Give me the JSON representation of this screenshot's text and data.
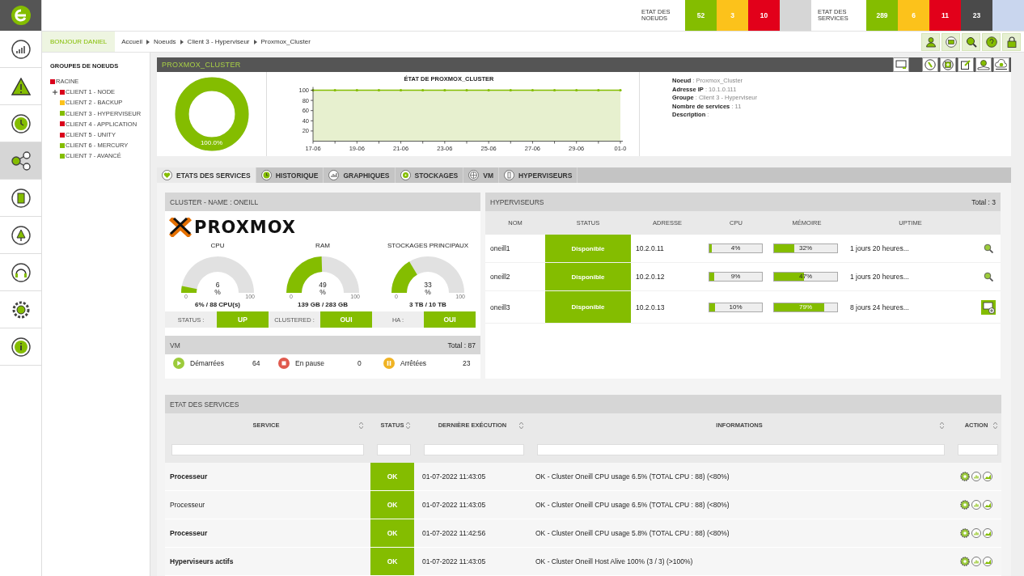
{
  "rail": {
    "items": [
      {
        "selected": false
      },
      {
        "selected": false
      },
      {
        "selected": false
      },
      {
        "selected": true
      },
      {
        "selected": false
      },
      {
        "selected": false
      },
      {
        "selected": false
      },
      {
        "selected": false
      },
      {
        "selected": false
      }
    ]
  },
  "top_bar": {
    "groups": [
      {
        "label": "ETAT DES NOEUDS",
        "counts": [
          {
            "value": "52",
            "color": "#84bd00"
          },
          {
            "value": "3",
            "color": "#fcc21b"
          },
          {
            "value": "10",
            "color": "#e2001a"
          },
          {
            "color": "#d6d6d6"
          }
        ]
      },
      {
        "label": "ETAT DES SERVICES",
        "counts": [
          {
            "value": "289",
            "color": "#84bd00"
          },
          {
            "value": "6",
            "color": "#fcc21b"
          },
          {
            "value": "11",
            "color": "#e2001a"
          },
          {
            "value": "23",
            "color": "#4a4a4a"
          },
          {
            "color": "#c9d6ee"
          }
        ]
      }
    ]
  },
  "greeting": "BONJOUR DANIEL",
  "breadcrumb": [
    "Accueil",
    "Noeuds",
    "Client 3 - Hyperviseur",
    "Proxmox_Cluster"
  ],
  "node_groups": {
    "title": "GROUPES DE NOEUDS",
    "root": {
      "label": "RACINE",
      "color": "#d9001b",
      "children": [
        {
          "label": "CLIENT 1 - NODE",
          "color": "#d9001b",
          "expandable": true
        },
        {
          "label": "CLIENT 2 - BACKUP",
          "color": "#fcc21b",
          "expandable": false
        },
        {
          "label": "CLIENT 3 - HYPERVISEUR",
          "color": "#84bd00",
          "expandable": false
        },
        {
          "label": "CLIENT 4 - APPLICATION",
          "color": "#d9001b",
          "expandable": false
        },
        {
          "label": "CLIENT 5 - UNITY",
          "color": "#d9001b",
          "expandable": false
        },
        {
          "label": "CLIENT 6 - MERCURY",
          "color": "#84bd00",
          "expandable": false
        },
        {
          "label": "CLIENT 7 - AVANCÉ",
          "color": "#84bd00",
          "expandable": false
        }
      ]
    }
  },
  "node": {
    "title": "PROXMOX_CLUSTER",
    "availability": {
      "level": 1,
      "reading": "100.0%"
    },
    "chart_data": {
      "type": "line",
      "title": "ÉTAT DE PROXMOX_CLUSTER",
      "categories": [
        "17-06",
        null,
        "19-06",
        null,
        "21-06",
        null,
        "23-06",
        null,
        "25-06",
        null,
        "27-06",
        null,
        "29-06",
        null,
        "01-0"
      ],
      "series": [
        {
          "color": "#84bd00",
          "values": [
            100,
            100,
            100,
            100,
            100,
            100,
            100,
            100,
            100,
            100,
            100,
            100,
            100,
            100,
            100
          ]
        }
      ],
      "ylim": [
        0,
        100
      ],
      "yticks": [
        20,
        40,
        60,
        80,
        100
      ]
    },
    "details": [
      {
        "label": "Noeud",
        "value": ": Proxmox_Cluster"
      },
      {
        "label": "Adresse IP",
        "value": ": 10.1.0.111"
      },
      {
        "label": "Groupe",
        "value": ": Client 3 - Hyperviseur"
      },
      {
        "label": "Nombre de services",
        "value": ": 11"
      },
      {
        "label": "Description",
        "value": ":"
      }
    ]
  },
  "tabs": [
    {
      "label": "ETATS DES SERVICES",
      "selected": true
    },
    {
      "label": "HISTORIQUE",
      "selected": false
    },
    {
      "label": "GRAPHIQUES",
      "selected": false
    },
    {
      "label": "STOCKAGES",
      "selected": false
    },
    {
      "label": "VM",
      "selected": false
    },
    {
      "label": "HYPERVISEURS",
      "selected": false
    }
  ],
  "cluster": {
    "title": "CLUSTER - NAME : ONEILL",
    "logo": "PROXMOX",
    "gauges": [
      {
        "title": "CPU",
        "level": 0.06,
        "value": "6",
        "unit": "%",
        "min": "0",
        "max": "100",
        "caption": "6% / 88 CPU(s)"
      },
      {
        "title": "RAM",
        "level": 0.49,
        "value": "49",
        "unit": "%",
        "min": "0",
        "max": "100",
        "caption": "139 GB / 283 GB"
      },
      {
        "title": "STOCKAGES PRINCIPAUX",
        "level": 0.33,
        "value": "33",
        "unit": "%",
        "min": "0",
        "max": "100",
        "caption": "3 TB / 10 TB"
      }
    ],
    "flags": [
      {
        "label": "STATUS :",
        "value": "UP"
      },
      {
        "label": "CLUSTERED :",
        "value": "OUI"
      },
      {
        "label": "HA :",
        "value": "OUI"
      }
    ],
    "vm": {
      "title": "VM",
      "total": "Total : 87",
      "states": [
        {
          "kind": "running",
          "label": "Démarrées",
          "count": "64"
        },
        {
          "kind": "paused",
          "label": "En pause",
          "count": "0"
        },
        {
          "kind": "stopped",
          "label": "Arrêtées",
          "count": "23"
        }
      ]
    }
  },
  "hypervisors": {
    "title": "HYPERVISEURS",
    "total": "Total : 3",
    "columns": [
      "NOM",
      "STATUS",
      "ADRESSE",
      "CPU",
      "MÉMOIRE",
      "UPTIME"
    ],
    "rows": [
      {
        "name": "oneill1",
        "status": "Disponible",
        "address": "10.2.0.11",
        "cpu": {
          "level": 0.04,
          "reading": "4%"
        },
        "memory": {
          "level": 0.32,
          "reading": "32%"
        },
        "uptime": "1 jours 20 heures...",
        "kind": "search"
      },
      {
        "name": "oneill2",
        "status": "Disponible",
        "address": "10.2.0.12",
        "cpu": {
          "level": 0.09,
          "reading": "9%"
        },
        "memory": {
          "level": 0.47,
          "reading": "47%"
        },
        "uptime": "1 jours 20 heures...",
        "kind": "search"
      },
      {
        "name": "oneill3",
        "status": "Disponible",
        "address": "10.2.0.13",
        "cpu": {
          "level": 0.1,
          "reading": "10%"
        },
        "memory": {
          "level": 0.79,
          "reading": "79%"
        },
        "uptime": "8 jours 24 heures...",
        "kind": "add"
      }
    ]
  },
  "services": {
    "title": "ETAT DES SERVICES",
    "columns": [
      "SERVICE",
      "STATUS",
      "DERNIÈRE EXÉCUTION",
      "INFORMATIONS",
      "ACTION"
    ],
    "rows": [
      {
        "service": "Processeur",
        "emphasized": true,
        "status": "OK",
        "last_run": "01-07-2022 11:43:05",
        "info": "OK - Cluster Oneill CPU usage 6.5% (TOTAL CPU : 88) (<80%)"
      },
      {
        "service": "Processeur",
        "emphasized": false,
        "status": "OK",
        "last_run": "01-07-2022 11:43:05",
        "info": "OK - Cluster Oneill CPU usage 6.5% (TOTAL CPU : 88) (<80%)"
      },
      {
        "service": "Processeur",
        "emphasized": true,
        "status": "OK",
        "last_run": "01-07-2022 11:42:56",
        "info": "OK - Cluster Oneill CPU usage 5.8% (TOTAL CPU : 88) (<80%)"
      },
      {
        "service": "Hyperviseurs actifs",
        "emphasized": true,
        "status": "OK",
        "last_run": "01-07-2022 11:43:05",
        "info": "OK - Cluster Oneill Host Alive 100% (3 / 3) (>100%)"
      }
    ]
  }
}
